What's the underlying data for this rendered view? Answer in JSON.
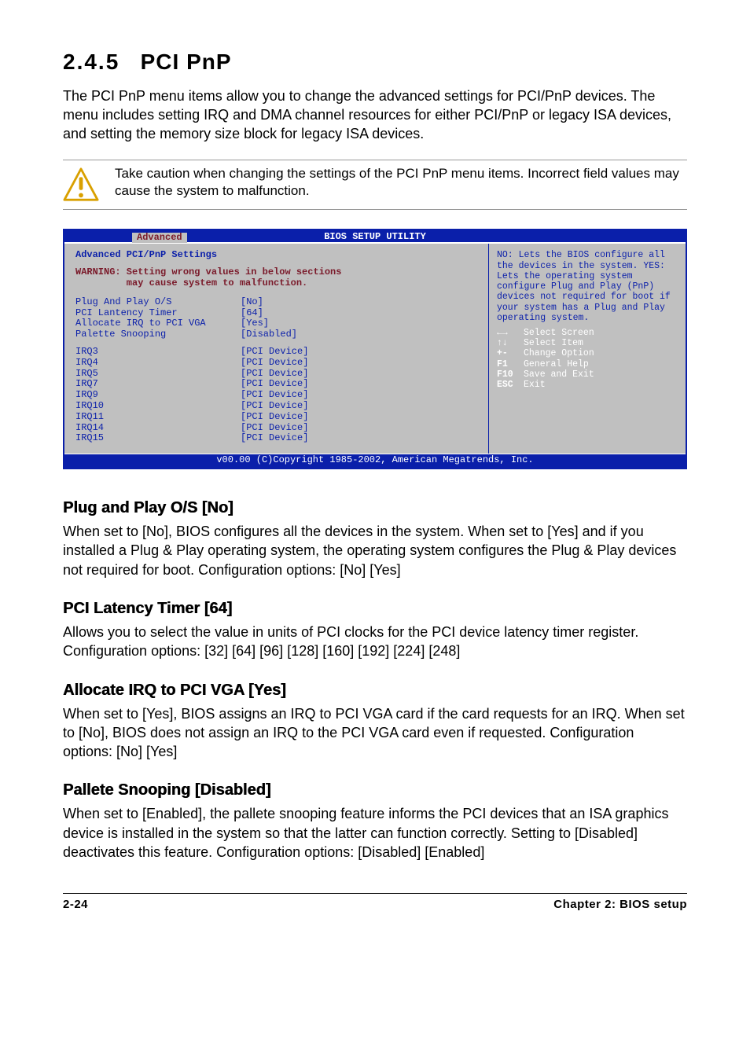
{
  "section": {
    "number": "2.4.5",
    "title": "PCI PnP",
    "intro": "The PCI PnP menu items allow you to change the advanced settings for PCI/PnP devices. The menu includes setting IRQ and DMA channel resources for either PCI/PnP or legacy ISA devices, and setting the memory size block for legacy ISA devices."
  },
  "caution": "Take caution when changing the settings of the PCI PnP menu items. Incorrect field values may cause the system to malfunction.",
  "bios": {
    "title": "BIOS SETUP UTILITY",
    "tab": "Advanced",
    "left_header": "Advanced PCI/PnP Settings",
    "warning_l1": "WARNING: Setting wrong values in below sections",
    "warning_l2": "         may cause system to malfunction.",
    "settings": [
      {
        "label": "Plug And Play O/S",
        "value": "[No]"
      },
      {
        "label": "PCI Lantency Timer",
        "value": "[64]"
      },
      {
        "label": "Allocate IRQ to PCI VGA",
        "value": "[Yes]"
      },
      {
        "label": "Palette Snooping",
        "value": "[Disabled]"
      }
    ],
    "irqs": [
      {
        "label": "IRQ3",
        "value": "[PCI Device]"
      },
      {
        "label": "IRQ4",
        "value": "[PCI Device]"
      },
      {
        "label": "IRQ5",
        "value": "[PCI Device]"
      },
      {
        "label": "IRQ7",
        "value": "[PCI Device]"
      },
      {
        "label": "IRQ9",
        "value": "[PCI Device]"
      },
      {
        "label": "IRQ10",
        "value": "[PCI Device]"
      },
      {
        "label": "IRQ11",
        "value": "[PCI Device]"
      },
      {
        "label": "IRQ14",
        "value": "[PCI Device]"
      },
      {
        "label": "IRQ15",
        "value": "[PCI Device]"
      }
    ],
    "help": "NO: Lets the BIOS configure all the devices in the system. YES: Lets the operating system configure Plug and Play (PnP) devices not required for boot if your system has a Plug and Play operating system.",
    "keys": [
      {
        "k": "←→",
        "d": "Select Screen"
      },
      {
        "k": "↑↓",
        "d": "Select Item"
      },
      {
        "k": "+-",
        "d": "Change Option"
      },
      {
        "k": "F1",
        "d": "General Help"
      },
      {
        "k": "F10",
        "d": "Save and Exit"
      },
      {
        "k": "ESC",
        "d": "Exit"
      }
    ],
    "footer": "v00.00 (C)Copyright 1985-2002, American Megatrends, Inc."
  },
  "subs": {
    "pnp": {
      "h": "Plug and Play O/S [No]",
      "p": "When set to [No], BIOS configures all the devices in the system. When set to [Yes] and if you installed a Plug & Play operating system, the operating system configures the Plug & Play devices not required for boot. Configuration options: [No] [Yes]"
    },
    "lat": {
      "h": "PCI Latency Timer [64]",
      "p": "Allows you to select the value in units of PCI clocks for the PCI device latency timer register. Configuration options: [32] [64] [96] [128] [160] [192] [224] [248]"
    },
    "irq": {
      "h": "Allocate IRQ to PCI VGA [Yes]",
      "p": "When set to [Yes], BIOS assigns an IRQ to PCI VGA card if the card requests for an IRQ. When set to [No], BIOS does not assign an IRQ to the PCI VGA card even if requested. Configuration options: [No] [Yes]"
    },
    "pal": {
      "h": "Pallete Snooping [Disabled]",
      "p": "When set to [Enabled], the pallete snooping feature informs the PCI devices that an ISA graphics device is installed in the system so that the latter can function correctly. Setting to [Disabled] deactivates this feature. Configuration options: [Disabled] [Enabled]"
    }
  },
  "footer": {
    "left": "2-24",
    "right": "Chapter 2: BIOS setup"
  }
}
